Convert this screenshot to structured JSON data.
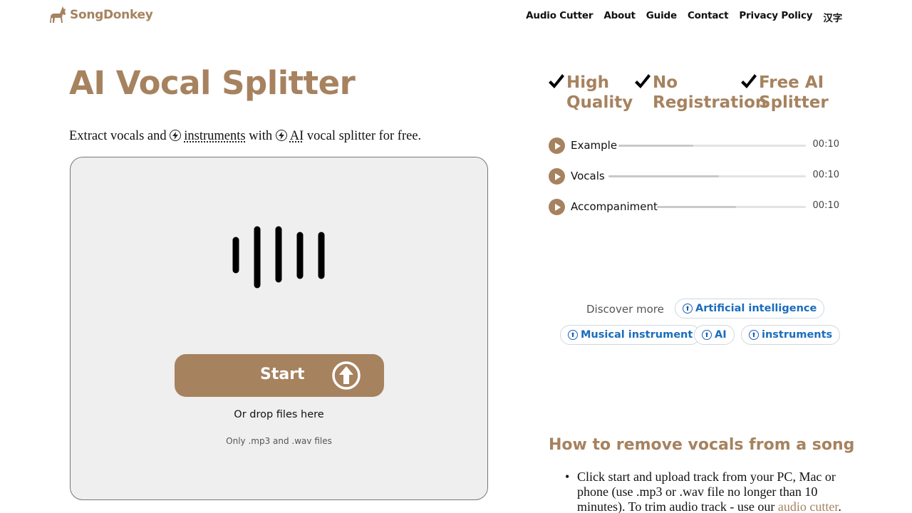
{
  "header": {
    "logo_text": "SongDonkey",
    "nav": [
      "Audio Cutter",
      "About",
      "Guide",
      "Contact",
      "Privacy Policy",
      "汉字"
    ]
  },
  "main": {
    "title": "AI Vocal Splitter",
    "intro": {
      "part1": "Extract vocals and ",
      "link1": "instruments",
      "part2": " with ",
      "link2": "AI",
      "part3": " vocal splitter for free."
    },
    "dropzone": {
      "start_label": "Start",
      "drop_text": "Or drop files here",
      "only_text": "Only .mp3 and .wav files"
    }
  },
  "features": [
    {
      "line1": "High",
      "line2": "Quality"
    },
    {
      "line1": "No",
      "line2": "Registration"
    },
    {
      "line1": "Free AI",
      "line2": "Splitter"
    }
  ],
  "players": [
    {
      "label": "Example",
      "time": "00:10",
      "progress": 0.4
    },
    {
      "label": "Vocals",
      "time": "00:10",
      "progress": 0.56
    },
    {
      "label": "Accompaniment",
      "time": "00:10",
      "progress": 0.53
    }
  ],
  "discover": {
    "label": "Discover more",
    "chips": [
      "Artificial intelligence",
      "Musical instrument",
      "AI",
      "instruments"
    ]
  },
  "howto": {
    "title": "How to remove vocals from a song",
    "step1_text": "Click start and upload track from your PC, Mac or phone (use .mp3 or .wav file no longer than 10 minutes). To trim audio track - use our ",
    "step1_link": "audio cutter",
    "step1_end": "."
  },
  "colors": {
    "brand": "#a6825f",
    "link_blue": "#1a6dbc",
    "dropzone_bg": "#efefef"
  }
}
